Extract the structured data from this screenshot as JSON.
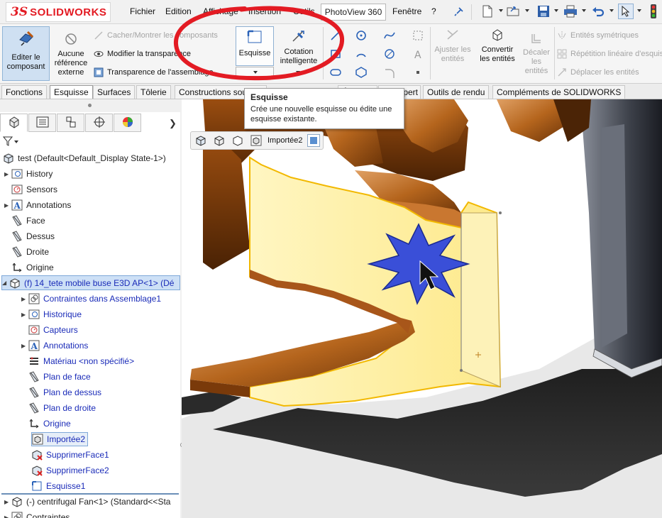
{
  "app": {
    "brand_ds": "3S",
    "brand_name": "SOLIDWORKS"
  },
  "menu": {
    "items": [
      "Fichier",
      "Edition",
      "Affichage",
      "Insertion",
      "Outils"
    ],
    "photoview": "PhotoView 360",
    "fenetre": "Fenêtre",
    "help": "?"
  },
  "commands": {
    "edit_component": "Editer le composant",
    "no_external_ref": "Aucune référence externe",
    "hide_show": "Cacher/Montrer les composants",
    "modify_transparency": "Modifier la transparence",
    "assembly_transparency": "Transparence de l'assemblage",
    "sketch": "Esquisse",
    "smart_dimension": "Cotation intelligente",
    "trim": "Ajuster les entités",
    "convert": "Convertir les entités",
    "offset": "Décaler les entités",
    "mirror": "Entités symétriques",
    "linear_pattern": "Répétition linéaire d'esquisse",
    "move": "Déplacer les entités"
  },
  "tabs": [
    "Fonctions",
    "Esquisse",
    "Surfaces",
    "Tôlerie",
    "Constructions soudées",
    "Évaluer",
    "DimXpert",
    "Outils de rendu",
    "Compléments de SOLIDWORKS"
  ],
  "active_tab": "Esquisse",
  "tooltip": {
    "title": "Esquisse",
    "body": "Crée une nouvelle esquisse ou édite une esquisse existante."
  },
  "breadcrumb": {
    "label": "Importée2"
  },
  "tree": {
    "root": "test  (Default<Default_Display State-1>)",
    "items": [
      {
        "label": "History",
        "icon": "history-icon"
      },
      {
        "label": "Sensors",
        "icon": "sensor-icon"
      },
      {
        "label": "Annotations",
        "icon": "annotation-icon"
      },
      {
        "label": "Face",
        "icon": "plane-icon"
      },
      {
        "label": "Dessus",
        "icon": "plane-icon"
      },
      {
        "label": "Droite",
        "icon": "plane-icon"
      },
      {
        "label": "Origine",
        "icon": "origin-icon"
      }
    ],
    "component": "(f) 14_tete mobile buse E3D AP<1> (Dé",
    "sub_items": [
      {
        "label": "Contraintes dans Assemblage1",
        "icon": "mate-icon"
      },
      {
        "label": "Historique",
        "icon": "history-icon"
      },
      {
        "label": "Capteurs",
        "icon": "sensor-icon"
      },
      {
        "label": "Annotations",
        "icon": "annotation-icon"
      },
      {
        "label": "Matériau <non spécifié>",
        "icon": "material-icon"
      },
      {
        "label": "Plan de face",
        "icon": "plane-icon"
      },
      {
        "label": "Plan de dessus",
        "icon": "plane-icon"
      },
      {
        "label": "Plan de droite",
        "icon": "plane-icon"
      },
      {
        "label": "Origine",
        "icon": "origin-icon"
      },
      {
        "label": "Importée2",
        "icon": "imported-body-icon"
      },
      {
        "label": "SupprimerFace1",
        "icon": "delete-face-icon"
      },
      {
        "label": "SupprimerFace2",
        "icon": "delete-face-icon"
      },
      {
        "label": "Esquisse1",
        "icon": "sketch-icon"
      }
    ],
    "fan": "(-) centrifugal Fan<1> (Standard<<Sta",
    "constraints": "Contraintes"
  },
  "colors": {
    "accent_red": "#e31b23",
    "selection_blue": "#cde0f6",
    "tree_blue": "#1a2bb8",
    "part_copper": "#b5651d",
    "face_highlight": "#fff4b0",
    "cursor_star": "#3a4fd8"
  }
}
